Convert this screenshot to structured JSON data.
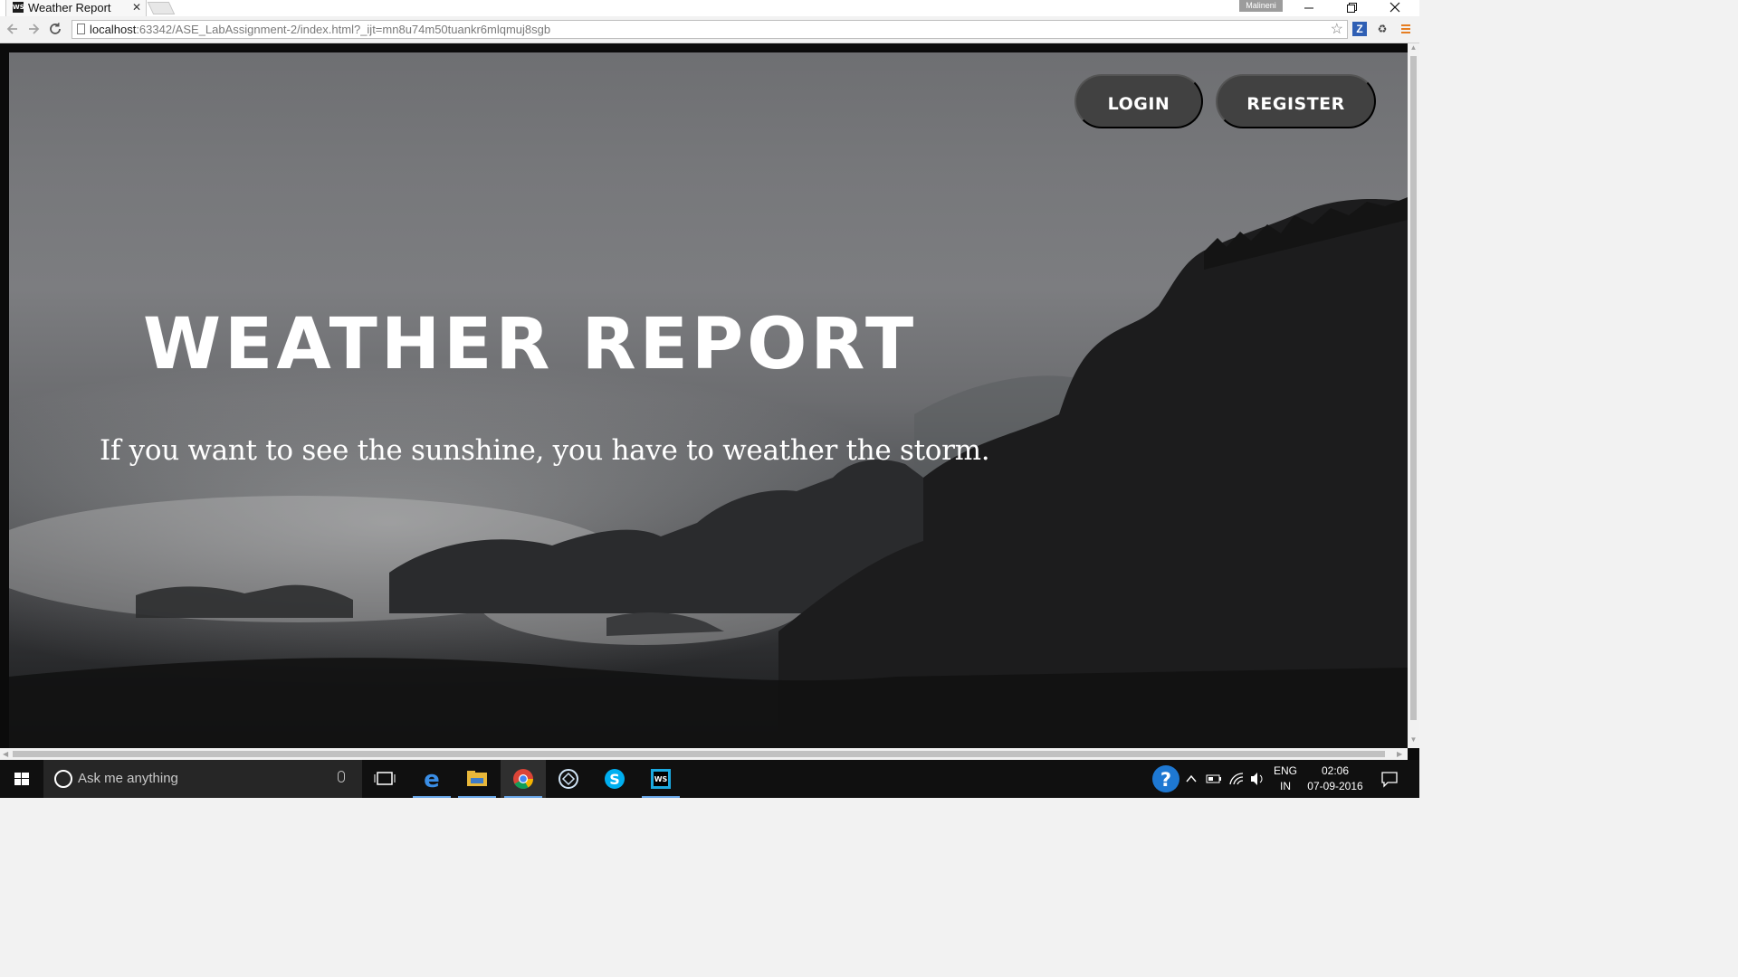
{
  "browser": {
    "tab_title": "Weather Report",
    "tab_favicon_text": "WS",
    "tab_close": "✕",
    "profile_name": "Malineni",
    "url_host": "localhost",
    "url_rest": ":63342/ASE_LabAssignment-2/index.html?_ijt=mn8u74m50tuankr6mlqmuj8sgb",
    "icons": [
      "back-icon",
      "forward-icon",
      "reload-icon",
      "star-icon",
      "extension-z-icon",
      "extension-recycle-icon",
      "menu-icon"
    ]
  },
  "page": {
    "login_label": "LOGIN",
    "register_label": "REGISTER",
    "hero_title": "WEATHER REPORT",
    "hero_tagline": "If you want to see the sunshine, you have to weather the storm."
  },
  "taskbar": {
    "search_placeholder": "Ask me anything",
    "language_top": "ENG",
    "language_bottom": "IN",
    "time": "02:06",
    "date": "07-09-2016",
    "apps": [
      "task-view",
      "edge",
      "file-explorer",
      "chrome",
      "app-circle",
      "skype",
      "webstorm"
    ],
    "accent_color": "#6aa7e8"
  }
}
